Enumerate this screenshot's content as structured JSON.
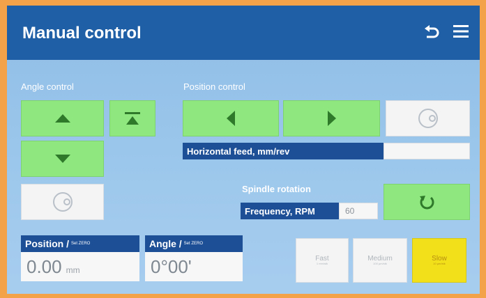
{
  "header": {
    "title": "Manual control",
    "back_icon": "undo-icon",
    "menu_icon": "hamburger-menu-icon"
  },
  "angle_control": {
    "label": "Angle control"
  },
  "position_control": {
    "label": "Position control",
    "horizontal_feed_label": "Horizontal feed, mm/rev",
    "horizontal_feed_value": ""
  },
  "spindle": {
    "label": "Spindle rotation",
    "frequency_label": "Frequency, RPM",
    "frequency_value": "60"
  },
  "readouts": {
    "position": {
      "label": "Position /",
      "set_zero": "Set ZERO",
      "value": "0.00",
      "unit": "mm"
    },
    "angle": {
      "label": "Angle /",
      "set_zero": "Set ZERO",
      "value": "0°00'"
    }
  },
  "speeds": [
    {
      "name": "Fast",
      "sub": "1 mm/stk",
      "state": "inactive"
    },
    {
      "name": "Medium",
      "sub": "100 µm/stk",
      "state": "inactive"
    },
    {
      "name": "Slow",
      "sub": "10 µm/stk",
      "state": "selected"
    }
  ],
  "colors": {
    "header": "#1f5fa6",
    "green_button": "#8ee87f",
    "selected_speed": "#f2e11a",
    "label_bar": "#1d4f96",
    "bezel": "#f3a24a"
  }
}
